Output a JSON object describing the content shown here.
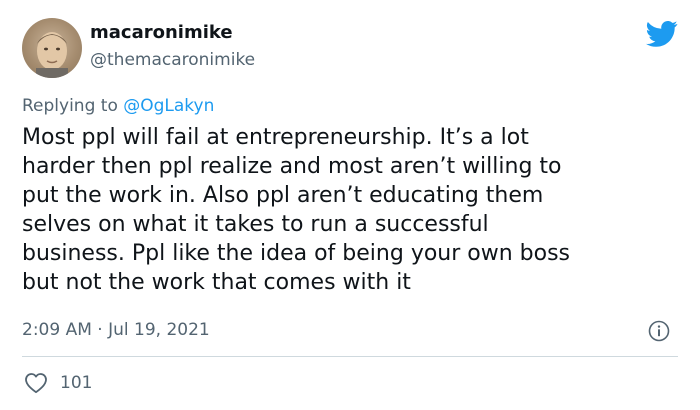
{
  "tweet": {
    "display_name": "macaronimike",
    "handle": "@themacaronimike",
    "replying_prefix": "Replying to ",
    "replying_to": "@OgLakyn",
    "text": "Most ppl will fail at entrepreneurship. It’s a lot\nharder then ppl realize and most aren’t willing to\nput the work in. Also ppl aren’t educating them\nselves on what it takes to run a successful\nbusiness. Ppl like the idea of being your own boss\nbut not the work that comes with it",
    "timestamp": "2:09 AM · Jul 19, 2021",
    "likes": "101"
  },
  "icons": {
    "brand": "twitter-bird-icon",
    "info": "info-icon",
    "like": "heart-icon"
  },
  "colors": {
    "brand": "#1d9bf0",
    "text": "#0f1419",
    "secondary": "#536471",
    "divider": "#cfd9de"
  }
}
